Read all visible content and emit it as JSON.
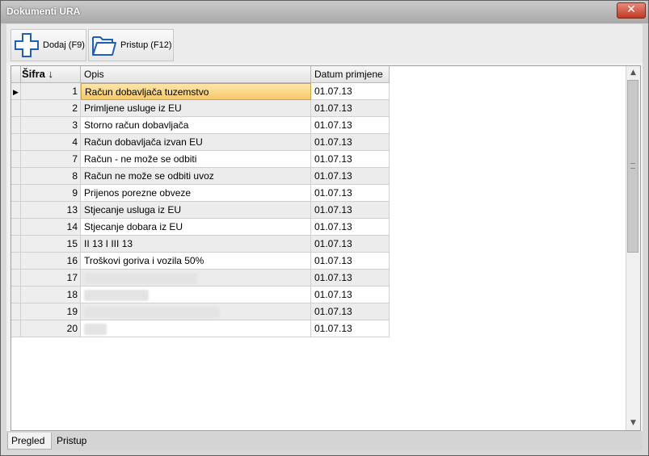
{
  "window": {
    "title": "Dokumenti URA",
    "close_glyph": "✕"
  },
  "toolbar": {
    "add_label": "Dodaj (F9)",
    "add_icon": "plus-icon",
    "open_label": "Pristup (F12)",
    "open_icon": "folder-open-icon"
  },
  "table": {
    "columns": {
      "code": "Šifra ↓",
      "description": "Opis",
      "date": "Datum primjene"
    },
    "current_row_marker": "▶",
    "rows": [
      {
        "code": "1",
        "description": "Račun dobavljača tuzemstvo",
        "date": "01.07.13",
        "selected": true
      },
      {
        "code": "2",
        "description": "Primljene usluge iz EU",
        "date": "01.07.13"
      },
      {
        "code": "3",
        "description": "Storno račun dobavljača",
        "date": "01.07.13"
      },
      {
        "code": "4",
        "description": "Račun dobavljača izvan EU",
        "date": "01.07.13"
      },
      {
        "code": "7",
        "description": "Račun - ne može se odbiti",
        "date": "01.07.13"
      },
      {
        "code": "8",
        "description": "Račun  ne može se odbiti uvoz",
        "date": "01.07.13"
      },
      {
        "code": "9",
        "description": "Prijenos porezne obveze",
        "date": "01.07.13"
      },
      {
        "code": "13",
        "description": "Stjecanje usluga iz EU",
        "date": "01.07.13"
      },
      {
        "code": "14",
        "description": "Stjecanje dobara iz EU",
        "date": "01.07.13"
      },
      {
        "code": "15",
        "description": "II 13 I III 13",
        "date": "01.07.13"
      },
      {
        "code": "16",
        "description": "Troškovi goriva i vozila 50%",
        "date": "01.07.13"
      },
      {
        "code": "17",
        "description": "",
        "redacted": true,
        "date": "01.07.13"
      },
      {
        "code": "18",
        "description": "",
        "redacted": true,
        "date": "01.07.13"
      },
      {
        "code": "19",
        "description": "",
        "redacted": true,
        "date": "01.07.13"
      },
      {
        "code": "20",
        "description": "",
        "redacted": true,
        "date": "01.07.13"
      }
    ]
  },
  "scrollbar": {
    "up_glyph": "▲",
    "down_glyph": "▼"
  },
  "tabs": [
    {
      "label": "Pregled",
      "active": true
    },
    {
      "label": "Pristup",
      "active": false
    }
  ]
}
